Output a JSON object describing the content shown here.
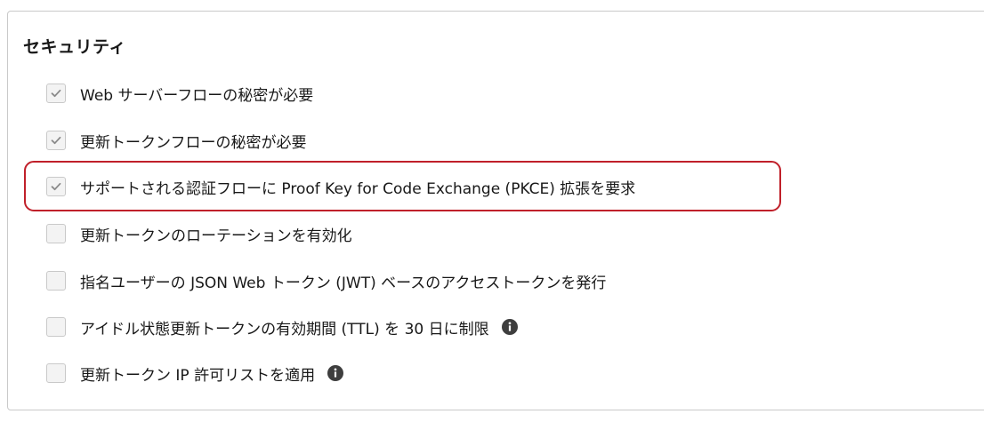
{
  "section": {
    "title": "セキュリティ"
  },
  "options": [
    {
      "label": "Web サーバーフローの秘密が必要",
      "checked": true,
      "info": false
    },
    {
      "label": "更新トークンフローの秘密が必要",
      "checked": true,
      "info": false
    },
    {
      "label": "サポートされる認証フローに Proof Key for Code Exchange (PKCE) 拡張を要求",
      "checked": true,
      "info": false
    },
    {
      "label": "更新トークンのローテーションを有効化",
      "checked": false,
      "info": false
    },
    {
      "label": "指名ユーザーの JSON Web トークン (JWT) ベースのアクセストークンを発行",
      "checked": false,
      "info": false
    },
    {
      "label": "アイドル状態更新トークンの有効期間 (TTL) を 30 日に制限",
      "checked": false,
      "info": true
    },
    {
      "label": "更新トークン IP 許可リストを適用",
      "checked": false,
      "info": true
    }
  ],
  "highlighted_option_index": 2,
  "colors": {
    "highlight_border": "#c0202a",
    "checkmark": "#8a8a8a",
    "info_icon": "#3e3e3e"
  }
}
